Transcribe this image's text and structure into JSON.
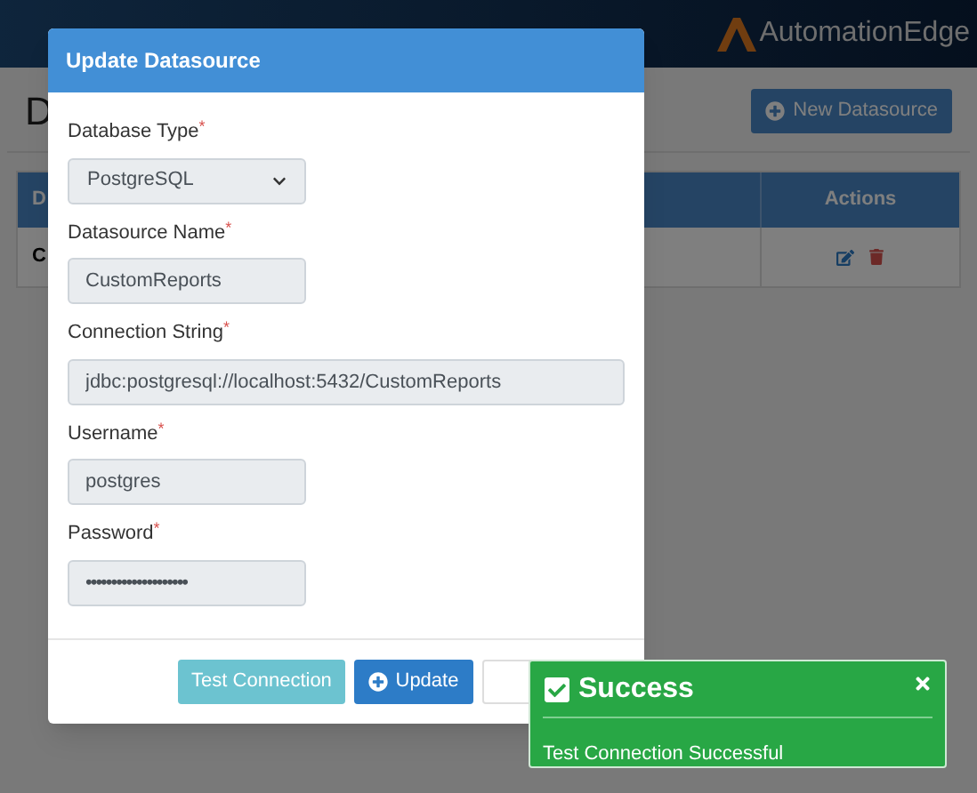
{
  "header": {
    "logo_text": "AutomationEdge"
  },
  "page": {
    "title": "D",
    "new_button": "New Datasource"
  },
  "table": {
    "columns": [
      "D",
      "Actions"
    ],
    "rows": [
      {
        "cells": [
          "C"
        ]
      }
    ]
  },
  "modal": {
    "title": "Update Datasource",
    "fields": [
      {
        "kind": "select",
        "label": "Database Type",
        "required_mark": "*",
        "value": "PostgreSQL",
        "wide": false
      },
      {
        "kind": "text",
        "label": "Datasource Name",
        "required_mark": "*",
        "value": "CustomReports",
        "wide": false
      },
      {
        "kind": "text",
        "label": "Connection String",
        "required_mark": "*",
        "value": "jdbc:postgresql://localhost:5432/CustomReports",
        "wide": true
      },
      {
        "kind": "text",
        "label": "Username",
        "required_mark": "*",
        "value": "postgres",
        "wide": false
      },
      {
        "kind": "password",
        "label": "Password",
        "required_mark": "*",
        "value": "••••••••••••••••••••",
        "wide": false
      }
    ],
    "buttons": [
      {
        "kind": "info",
        "label": "Test Connection"
      },
      {
        "kind": "primary",
        "label": "Update"
      },
      {
        "kind": "default"
      }
    ]
  },
  "toast": {
    "title": "Success",
    "message": "Test Connection Successful"
  }
}
